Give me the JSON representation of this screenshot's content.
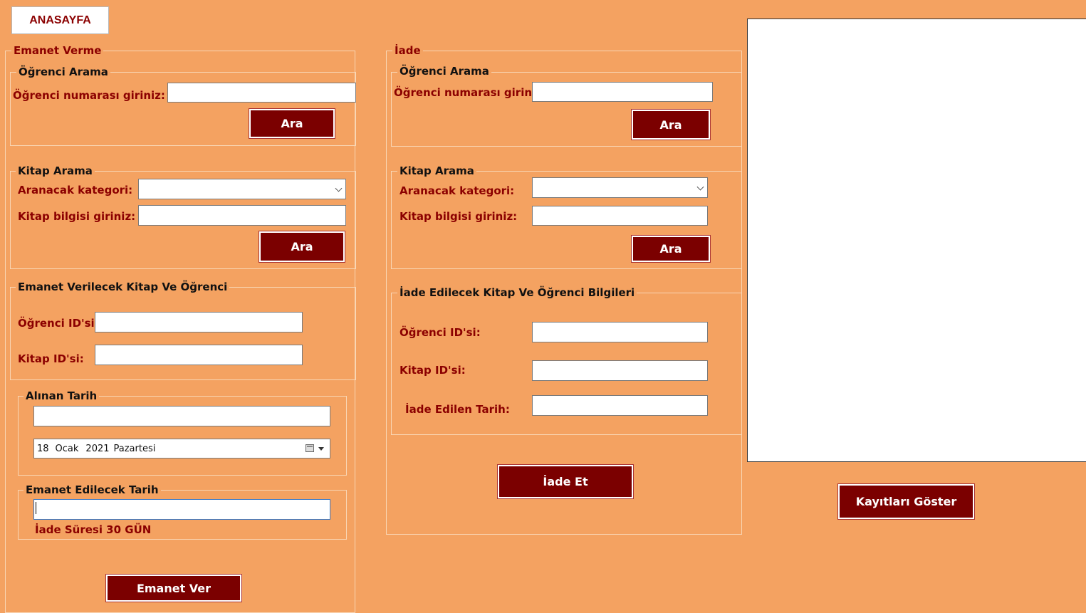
{
  "home_button": "ANASAYFA",
  "emanet": {
    "group_title": "Emanet Verme",
    "student_search": {
      "title": "Öğrenci Arama",
      "label": "Öğrenci numarası giriniz:",
      "value": "",
      "button": "Ara"
    },
    "book_search": {
      "title": "Kitap Arama",
      "category_label": "Aranacak kategori:",
      "category_value": "",
      "info_label": "Kitap bilgisi giriniz:",
      "info_value": "",
      "button": "Ara"
    },
    "selection": {
      "title": "Emanet Verilecek Kitap Ve Öğrenci",
      "student_id_label": "Öğrenci ID'si",
      "student_id_value": "",
      "book_id_label": "Kitap ID'si:",
      "book_id_value": ""
    },
    "taken_date": {
      "title": "Alınan Tarih",
      "value": "",
      "picker": {
        "day": "18",
        "month": "Ocak",
        "year": "2021",
        "weekday": "Pazartesi"
      }
    },
    "due_date": {
      "title": "Emanet Edilecek Tarih",
      "value": "",
      "note": "İade Süresi 30 GÜN"
    },
    "submit_button": "Emanet Ver"
  },
  "iade": {
    "group_title": "İade",
    "student_search": {
      "title": "Öğrenci Arama",
      "label": "Öğrenci numarası giriniz:",
      "value": "",
      "button": "Ara"
    },
    "book_search": {
      "title": "Kitap Arama",
      "category_label": "Aranacak kategori:",
      "category_value": "",
      "info_label": "Kitap bilgisi giriniz:",
      "info_value": "",
      "button": "Ara"
    },
    "details": {
      "title": "İade Edilecek Kitap Ve Öğrenci  Bilgileri",
      "student_id_label": "Öğrenci ID'si:",
      "student_id_value": "",
      "book_id_label": "Kitap ID'si:",
      "book_id_value": "",
      "return_date_label": "İade Edilen Tarih:",
      "return_date_value": ""
    },
    "submit_button": "İade Et"
  },
  "records_button": "Kayıtları Göster",
  "colors": {
    "background": "#f4a261",
    "button": "#7b0000",
    "label": "#8b0000"
  }
}
